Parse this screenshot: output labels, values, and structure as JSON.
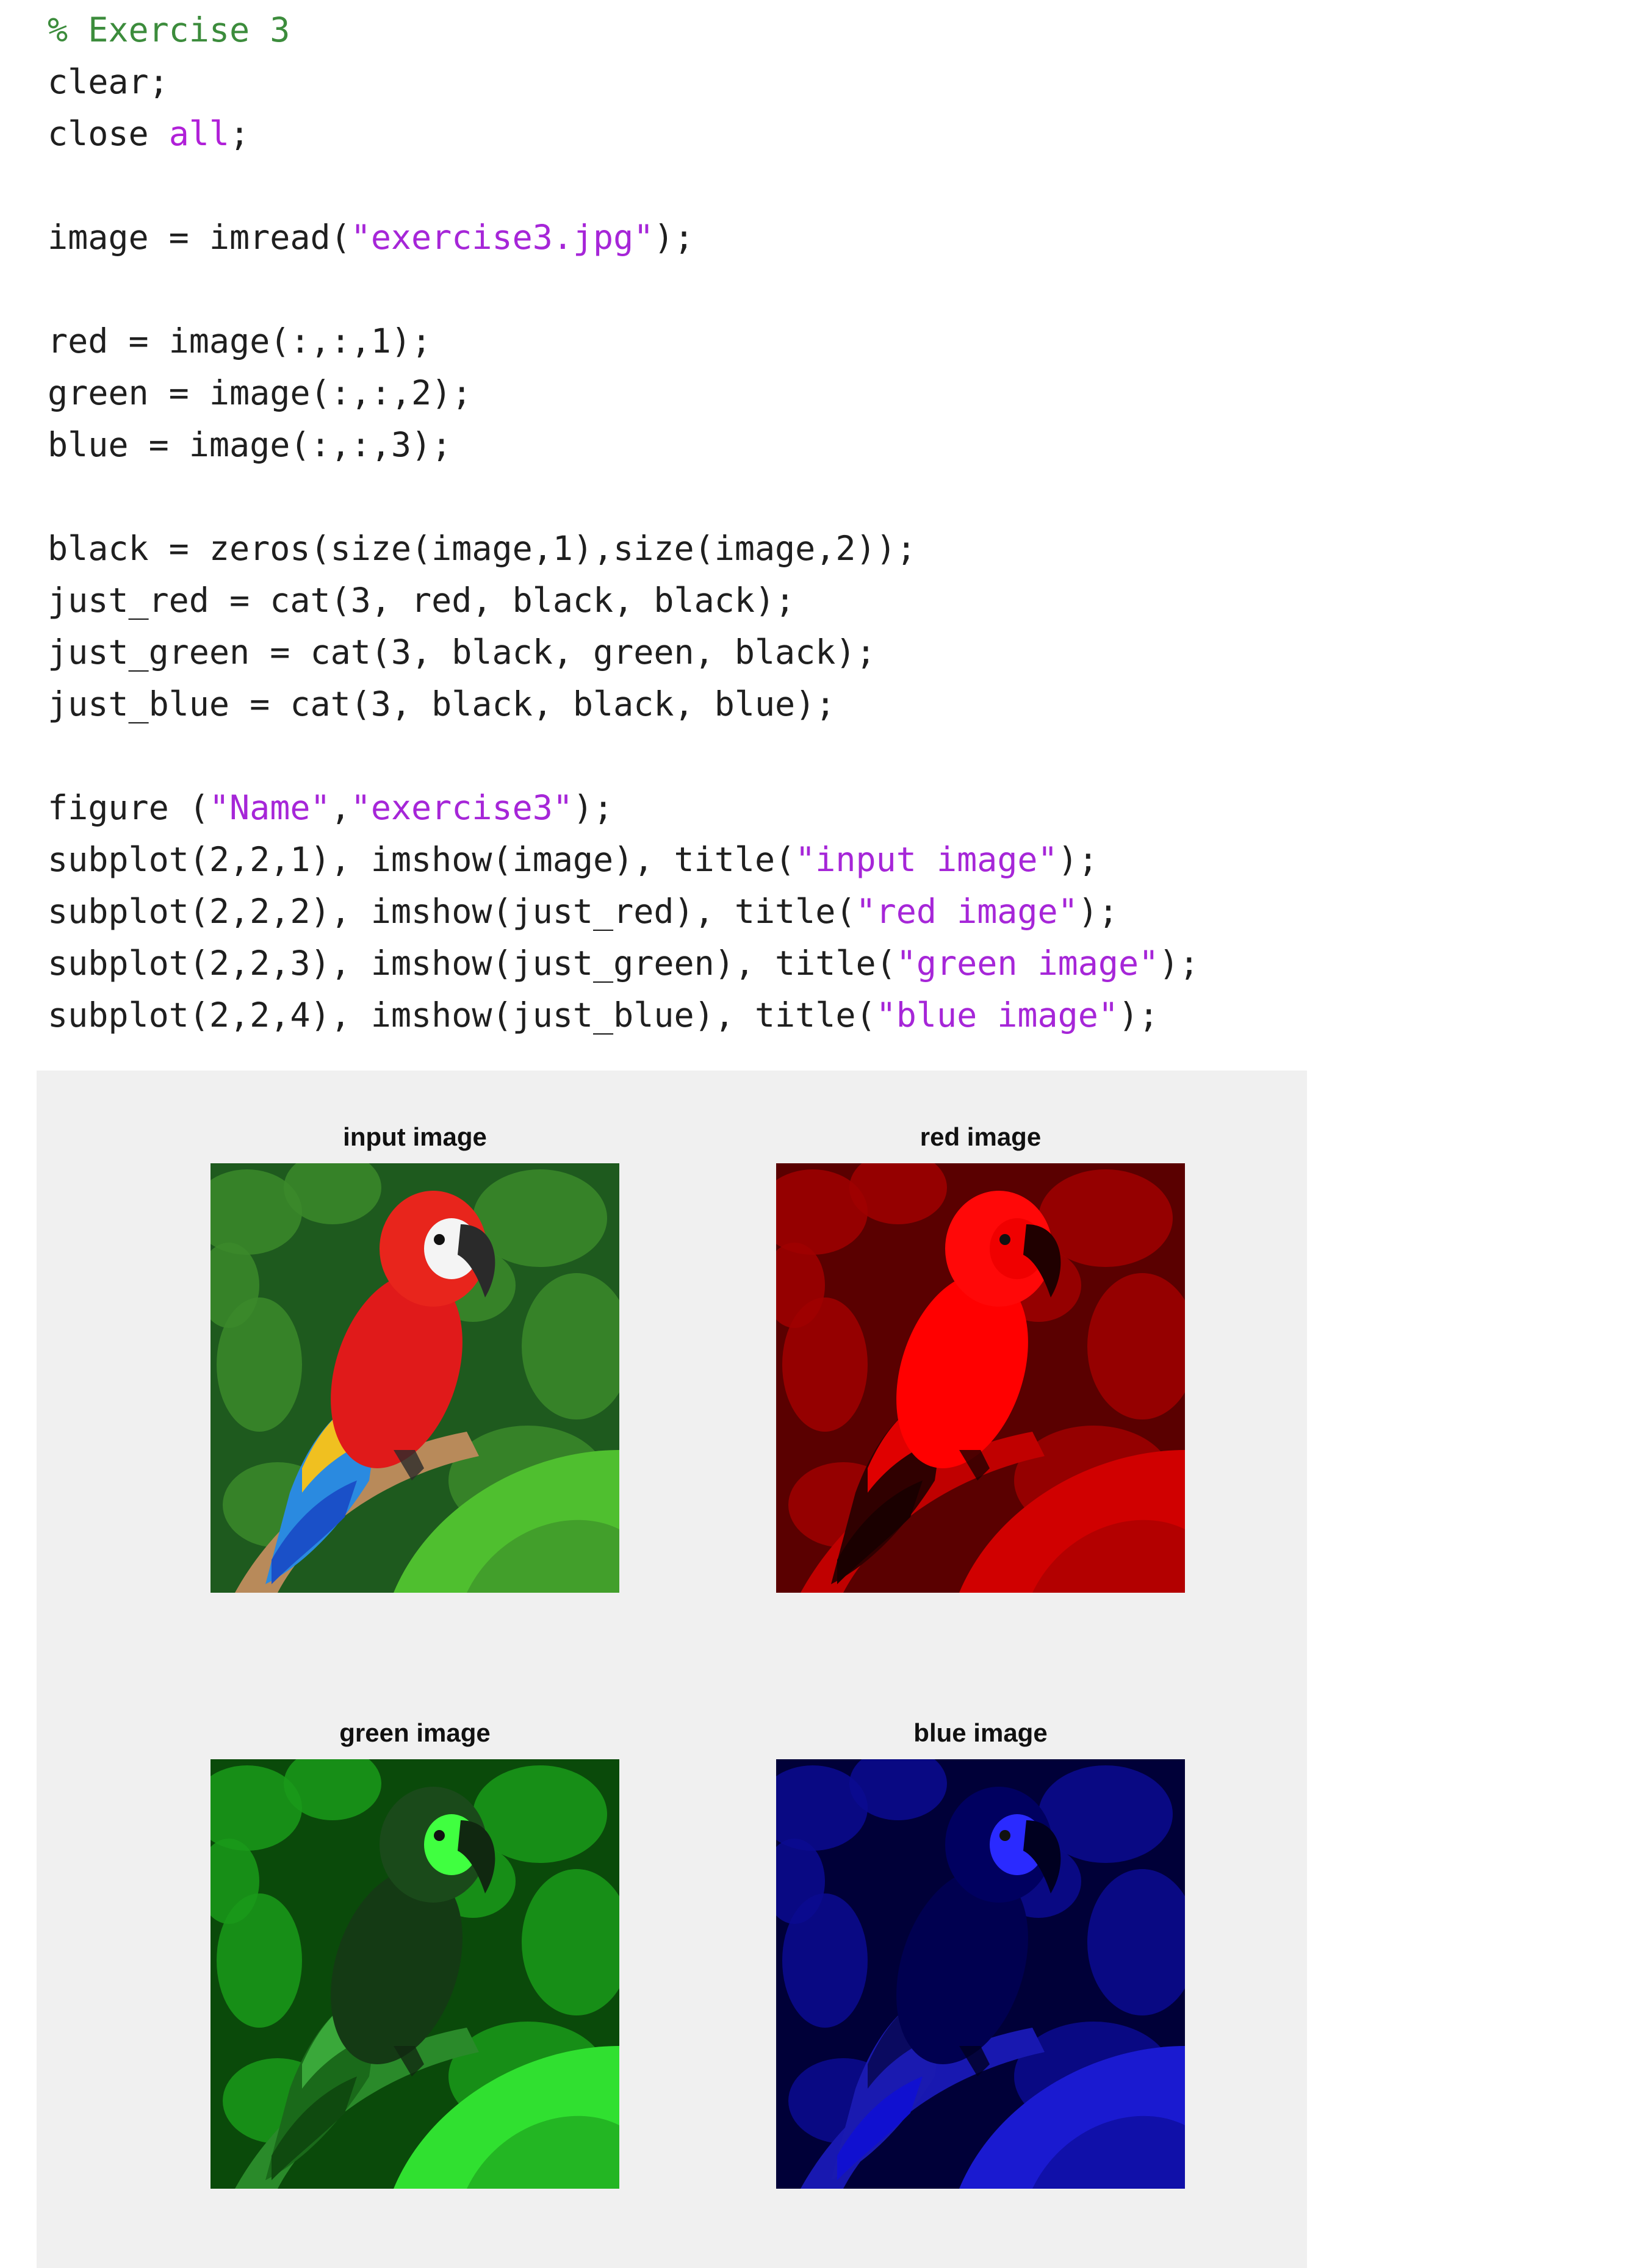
{
  "editor": {
    "lines": [
      {
        "parts": [
          {
            "t": "% Exercise 3",
            "c": "cmt"
          }
        ]
      },
      {
        "parts": [
          {
            "t": "clear;",
            "c": ""
          }
        ]
      },
      {
        "parts": [
          {
            "t": "close ",
            "c": ""
          },
          {
            "t": "all",
            "c": "kw"
          },
          {
            "t": ";",
            "c": ""
          }
        ]
      },
      {
        "blank": true
      },
      {
        "parts": [
          {
            "t": "image = imread(",
            "c": ""
          },
          {
            "t": "\"exercise3.jpg\"",
            "c": "str"
          },
          {
            "t": ");",
            "c": ""
          }
        ]
      },
      {
        "blank": true
      },
      {
        "parts": [
          {
            "t": "red = image(:,:,1);",
            "c": ""
          }
        ]
      },
      {
        "parts": [
          {
            "t": "green = image(:,:,2);",
            "c": ""
          }
        ]
      },
      {
        "parts": [
          {
            "t": "blue = image(:,:,3);",
            "c": ""
          }
        ]
      },
      {
        "blank": true
      },
      {
        "parts": [
          {
            "t": "black = zeros(size(image,1),size(image,2));",
            "c": ""
          }
        ]
      },
      {
        "parts": [
          {
            "t": "just_red = cat(3, red, black, black);",
            "c": ""
          }
        ]
      },
      {
        "parts": [
          {
            "t": "just_green = cat(3, black, green, black);",
            "c": ""
          }
        ]
      },
      {
        "parts": [
          {
            "t": "just_blue = cat(3, black, black, blue);",
            "c": ""
          }
        ]
      },
      {
        "blank": true
      },
      {
        "parts": [
          {
            "t": "figure (",
            "c": ""
          },
          {
            "t": "\"Name\"",
            "c": "str"
          },
          {
            "t": ",",
            "c": ""
          },
          {
            "t": "\"exercise3\"",
            "c": "str"
          },
          {
            "t": ");",
            "c": ""
          }
        ]
      },
      {
        "parts": [
          {
            "t": "subplot(2,2,1), imshow(image), title(",
            "c": ""
          },
          {
            "t": "\"input image\"",
            "c": "str"
          },
          {
            "t": ");",
            "c": ""
          }
        ]
      },
      {
        "parts": [
          {
            "t": "subplot(2,2,2), imshow(just_red), title(",
            "c": ""
          },
          {
            "t": "\"red image\"",
            "c": "str"
          },
          {
            "t": ");",
            "c": ""
          }
        ]
      },
      {
        "parts": [
          {
            "t": "subplot(2,2,3), imshow(just_green), title(",
            "c": ""
          },
          {
            "t": "\"green image\"",
            "c": "str"
          },
          {
            "t": ");",
            "c": ""
          }
        ]
      },
      {
        "parts": [
          {
            "t": "subplot(2,2,4), imshow(just_blue), title(",
            "c": ""
          },
          {
            "t": "\"blue image\"",
            "c": "str"
          },
          {
            "t": ");",
            "c": ""
          }
        ]
      }
    ]
  },
  "figure": {
    "background": "#f0f0f0",
    "panels": [
      {
        "title": "input image",
        "mode": "color"
      },
      {
        "title": "red image",
        "mode": "red"
      },
      {
        "title": "green image",
        "mode": "green"
      },
      {
        "title": "blue image",
        "mode": "blue"
      }
    ]
  }
}
